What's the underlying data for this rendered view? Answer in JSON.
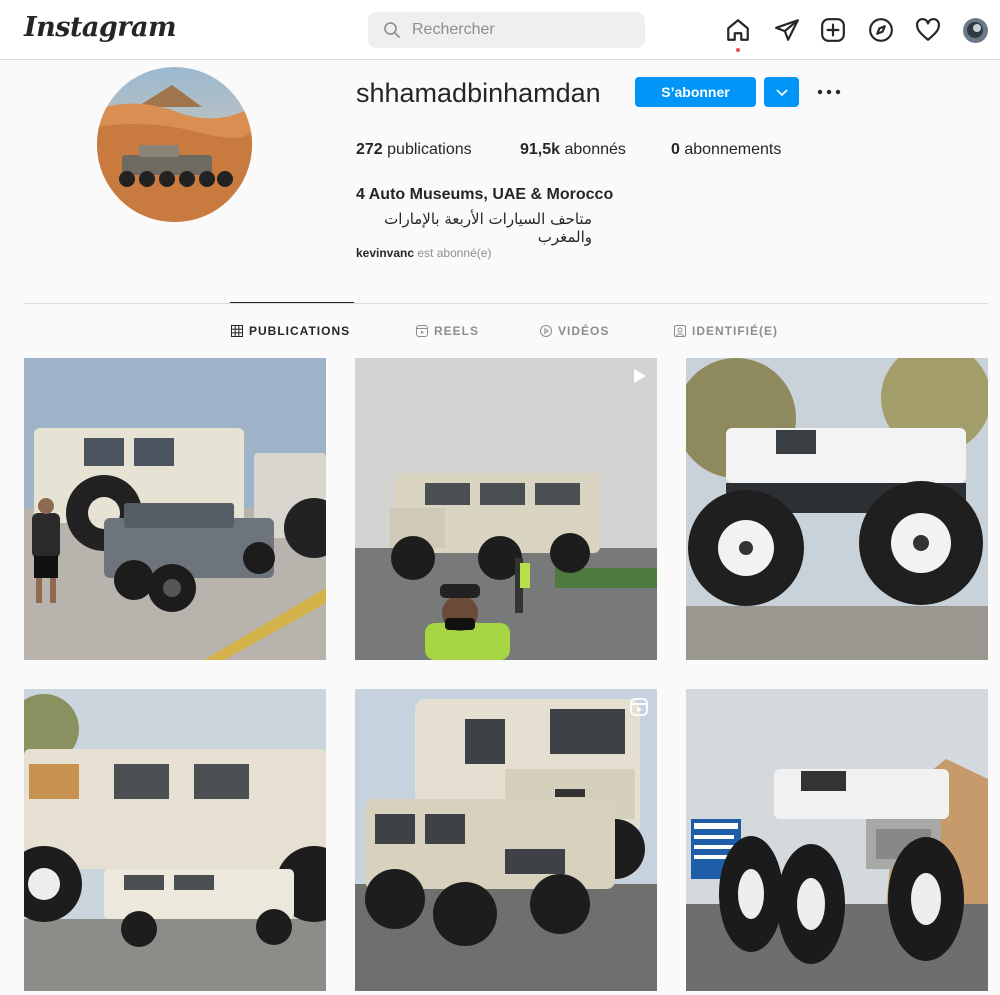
{
  "nav": {
    "logo": "Instagram",
    "search_placeholder": "Rechercher",
    "icons": [
      "home-icon",
      "direct-message-icon",
      "new-post-icon",
      "explore-icon",
      "activity-icon",
      "profile-avatar"
    ]
  },
  "profile": {
    "username": "shhamadbinhamdan",
    "follow_label": "S’abonner",
    "stats": {
      "posts_count": "272",
      "posts_label": "publications",
      "followers_count": "91,5k",
      "followers_label": "abonnés",
      "following_count": "0",
      "following_label": "abonnements"
    },
    "bio_name": "4 Auto Museums, UAE & Morocco",
    "bio_arabic": "متاحف السيارات الأربعة بالإمارات والمغرب",
    "followed_by_user": "kevinvanc",
    "followed_by_suffix": "est abonné(e)"
  },
  "tabs": [
    {
      "label": "PUBLICATIONS",
      "icon": "grid-icon",
      "active": true
    },
    {
      "label": "REELS",
      "icon": "reels-icon",
      "active": false
    },
    {
      "label": "VIDÉOS",
      "icon": "video-icon",
      "active": false
    },
    {
      "label": "IDENTIFIÉ(E)",
      "icon": "tagged-icon",
      "active": false
    }
  ],
  "posts": [
    {
      "subject": "white hummer and grey jeep",
      "badge": null
    },
    {
      "subject": "tall hummer on road",
      "badge": "video-icon"
    },
    {
      "subject": "white monster pickup truck",
      "badge": null
    },
    {
      "subject": "giant hummer over small hummer",
      "badge": null
    },
    {
      "subject": "giant hummer hummer rear view",
      "badge": "reels-icon"
    },
    {
      "subject": "monster ram truck on highway",
      "badge": null
    }
  ],
  "colors": {
    "accent": "#0095f6",
    "text": "#262626",
    "muted": "#8e8e8e",
    "border": "#dbdbdb",
    "background": "#fafafa"
  }
}
